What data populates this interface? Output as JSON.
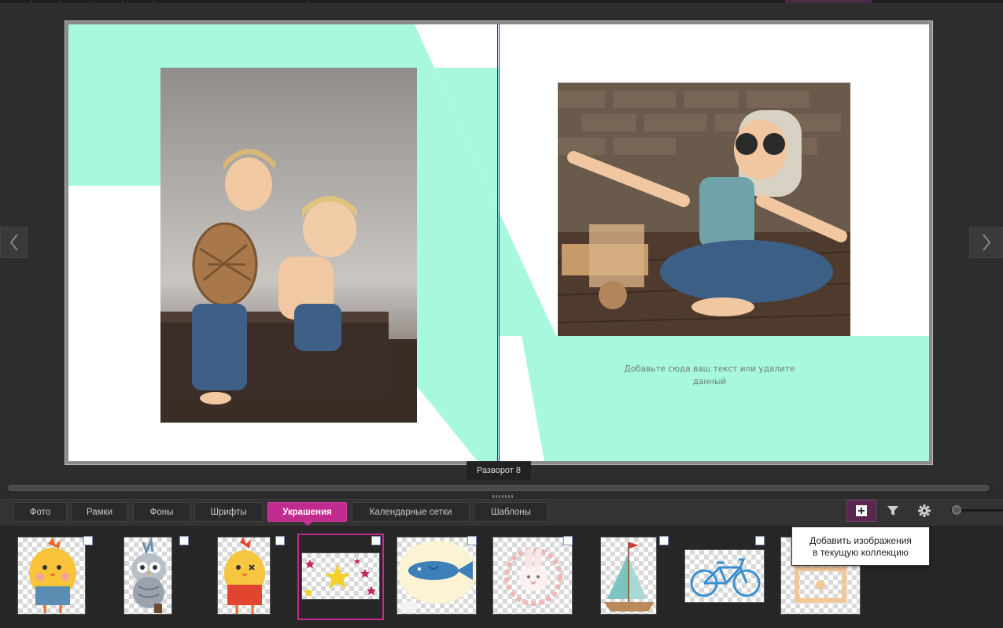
{
  "spread": {
    "label": "Разворот 8",
    "placeholder_text": "Добавьте сюда ваш текст или удалите данный",
    "accent_color": "#a8f8e0",
    "divider_color": "#1e2fb8"
  },
  "photos": {
    "left": {
      "name": "two-boys-on-suitcase-photo"
    },
    "right": {
      "name": "boy-with-airplane-toy-photo"
    }
  },
  "navigation": {
    "prev_icon": "chevron-left-icon",
    "next_icon": "chevron-right-icon"
  },
  "tabs": [
    {
      "label": "Фото"
    },
    {
      "label": "Рамки"
    },
    {
      "label": "Фоны"
    },
    {
      "label": "Шрифты"
    },
    {
      "label": "Украшения",
      "active": true
    },
    {
      "label": "Календарные сетки"
    },
    {
      "label": "Шаблоны"
    }
  ],
  "toolbar": {
    "add_icon": "plus-square-icon",
    "filter_icon": "filter-icon",
    "settings_icon": "gear-icon",
    "tooltip_line1": "Добавить изображения",
    "tooltip_line2": "в текущую коллекцию",
    "active_color": "#c12a8e"
  },
  "thumbnails": [
    {
      "name": "yellow-chick-sticker"
    },
    {
      "name": "owl-sticker"
    },
    {
      "name": "red-chick-sticker"
    },
    {
      "name": "stars-sticker",
      "selected": true
    },
    {
      "name": "fish-sticker"
    },
    {
      "name": "bunny-wreath-sticker"
    },
    {
      "name": "sailboat-sticker"
    },
    {
      "name": "bicycle-sticker"
    },
    {
      "name": "frame-sticker"
    }
  ]
}
